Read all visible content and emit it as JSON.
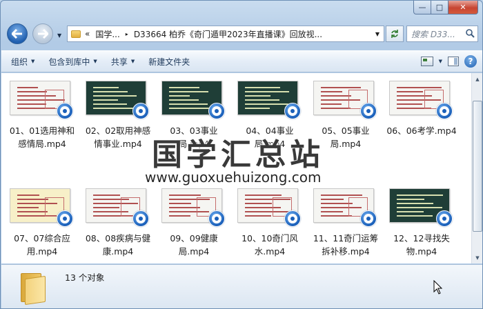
{
  "window": {
    "caption": {
      "minimize": "—",
      "maximize": "□",
      "close": "✕"
    }
  },
  "address_bar": {
    "overflow": "«",
    "segments": [
      "国学...",
      "D33664 柏乔《奇门遁甲2023年直播课》回放视..."
    ],
    "separator": "▸"
  },
  "search": {
    "placeholder": "搜索 D33..."
  },
  "toolbar": {
    "organize": "组织",
    "include_in_library": "包含到库中",
    "share": "共享",
    "new_folder": "新建文件夹",
    "help": "?"
  },
  "files": [
    {
      "name": "01、01选用神和感情局.mp4",
      "style": "light"
    },
    {
      "name": "02、02取用神感情事业.mp4",
      "style": "dark"
    },
    {
      "name": "03、03事业局.mp4",
      "style": "dark"
    },
    {
      "name": "04、04事业局.mp4",
      "style": "dark"
    },
    {
      "name": "05、05事业局.mp4",
      "style": "light"
    },
    {
      "name": "06、06考学.mp4",
      "style": "light"
    },
    {
      "name": "07、07综合应用.mp4",
      "style": "yellow"
    },
    {
      "name": "08、08疾病与健康.mp4",
      "style": "light"
    },
    {
      "name": "09、09健康局.mp4",
      "style": "light"
    },
    {
      "name": "10、10奇门风水.mp4",
      "style": "light"
    },
    {
      "name": "11、11奇门运筹拆补移.mp4",
      "style": "light"
    },
    {
      "name": "12、12寻找失物.mp4",
      "style": "dark"
    }
  ],
  "watermark": {
    "text": "国学汇总站",
    "url": "www.guoxuehuizong.com"
  },
  "details": {
    "count": "13 个对象"
  }
}
